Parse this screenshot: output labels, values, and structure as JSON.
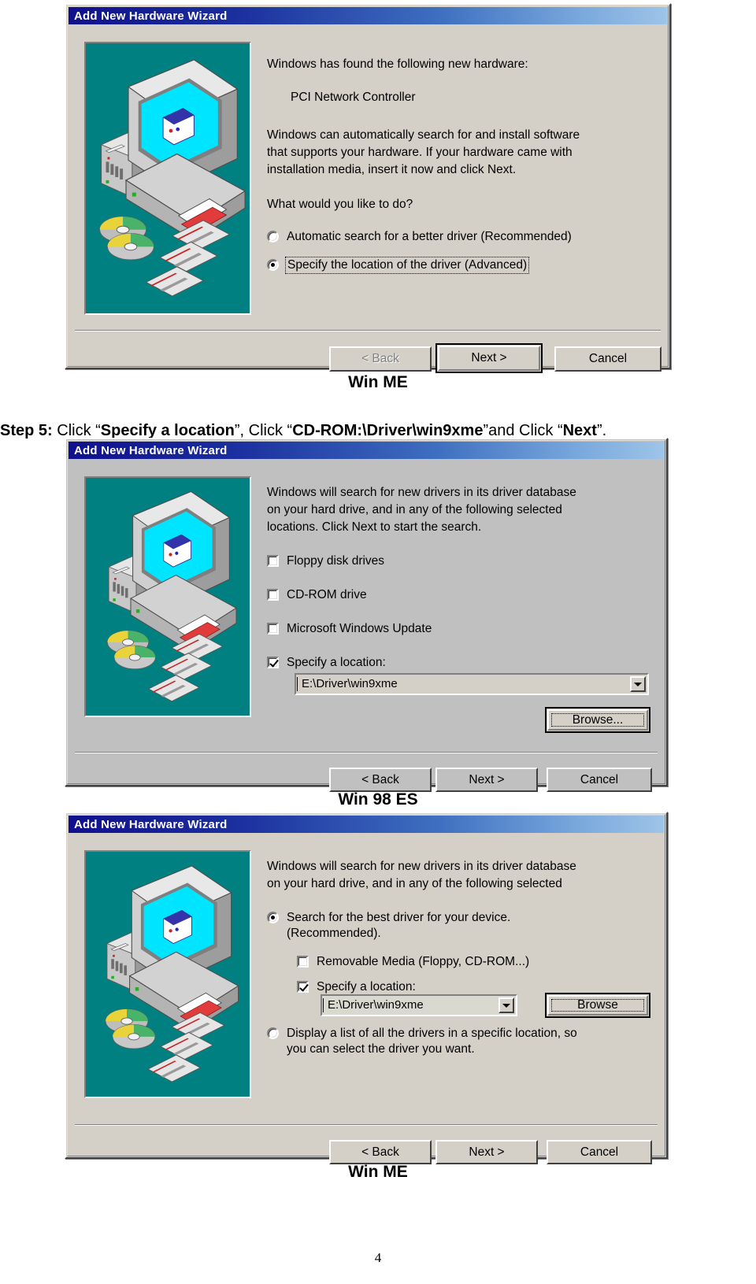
{
  "page": {
    "number": "4"
  },
  "step": {
    "prefix": "Step 5:",
    "t1": " Click “",
    "b1": "Specify a location",
    "t2": "”, Click “",
    "b2": "CD-ROM:\\Driver\\win9xme",
    "t3": "”and Click “",
    "b3": "Next",
    "t4": "”."
  },
  "dialog1": {
    "title": "Add New Hardware Wizard",
    "caption": "Win ME",
    "heading": "Windows has found the following new hardware:",
    "device": "PCI Network Controller",
    "body": "Windows can automatically search for and install software\nthat supports your hardware. If your hardware came with\ninstallation media, insert it now and click Next.",
    "question": "What would you like to do?",
    "options": [
      {
        "label": "Automatic search for a better driver (Recommended)",
        "accel": "A",
        "selected": false,
        "focused": false
      },
      {
        "label": "Specify the location of the driver (Advanced)",
        "accel": "S",
        "selected": true,
        "focused": true
      }
    ],
    "buttons": {
      "back": "< Back",
      "next": "Next >",
      "cancel": "Cancel",
      "back_enabled": false,
      "next_default": true
    },
    "art_icon": "computer-cds-cards-illustration"
  },
  "dialog2": {
    "title": "Add New Hardware Wizard",
    "caption": "Win 98 ES",
    "body": "Windows will search for new drivers in its driver database\non your hard drive, and in any of the following selected\nlocations. Click Next to start the search.",
    "checkboxes": [
      {
        "label": "Floppy disk drives",
        "accel": "F",
        "checked": false
      },
      {
        "label": "CD-ROM drive",
        "accel": "C",
        "checked": false
      },
      {
        "label": "Microsoft Windows Update",
        "accel": "M",
        "checked": false
      },
      {
        "label": "Specify a location:",
        "accel": "l",
        "checked": true
      }
    ],
    "location_value": "E:\\Driver\\win9xme",
    "browse_label": "Browse...",
    "browse_accel": "r",
    "buttons": {
      "back": "< Back",
      "next": "Next >",
      "cancel": "Cancel"
    },
    "art_icon": "computer-cds-cards-illustration"
  },
  "dialog3": {
    "title": "Add New Hardware Wizard",
    "caption": "Win ME",
    "body": "Windows will search for new drivers in its driver database\non your hard drive, and in any of the following selected",
    "radio1": "Search for the best driver for your device.\n(Recommended).",
    "radio1_selected": true,
    "checkboxes": [
      {
        "label": "Removable Media (Floppy, CD-ROM...)",
        "accel": "M",
        "checked": false
      },
      {
        "label": "Specify a location:",
        "accel": "l",
        "checked": true
      }
    ],
    "location_value": "E:\\Driver\\win9xme",
    "browse_label": "Browse",
    "browse_accel": "r",
    "radio2": "Display a list of all the drivers in a specific location, so\nyou can select the driver you want.",
    "radio2_selected": false,
    "buttons": {
      "back": "< Back",
      "next": "Next >",
      "cancel": "Cancel"
    },
    "art_icon": "computer-cds-cards-illustration"
  },
  "colors": {
    "dialog_face": "#d4d0c8",
    "dialog_face_alt": "#c0c0c0",
    "title_start": "#10108c",
    "title_end": "#9ec4e8",
    "art_teal": "#008080",
    "text": "#000000"
  }
}
